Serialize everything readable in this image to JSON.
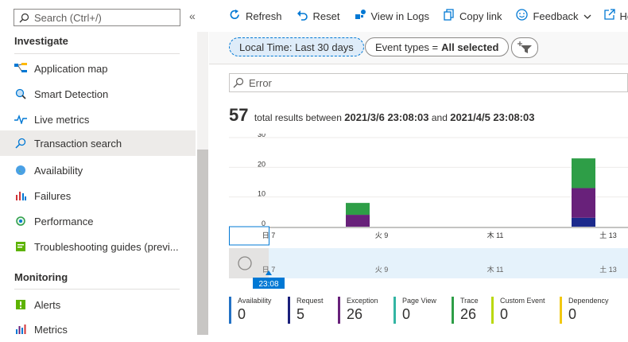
{
  "sidebar": {
    "search_placeholder": "Search (Ctrl+/)",
    "collapse_label": "«",
    "sections": [
      {
        "title": "Investigate"
      },
      {
        "title": "Monitoring"
      }
    ],
    "items": [
      {
        "label": "Application map",
        "icon": "application-map-icon"
      },
      {
        "label": "Smart Detection",
        "icon": "smart-detection-icon"
      },
      {
        "label": "Live metrics",
        "icon": "live-metrics-icon"
      },
      {
        "label": "Transaction search",
        "icon": "search-icon",
        "active": true
      },
      {
        "label": "Availability",
        "icon": "globe-icon"
      },
      {
        "label": "Failures",
        "icon": "failures-icon"
      },
      {
        "label": "Performance",
        "icon": "performance-icon"
      },
      {
        "label": "Troubleshooting guides (previ...",
        "icon": "notebook-icon"
      },
      {
        "label": "Alerts",
        "icon": "alerts-icon"
      },
      {
        "label": "Metrics",
        "icon": "metrics-icon"
      }
    ]
  },
  "toolbar": {
    "refresh": "Refresh",
    "reset": "Reset",
    "view_in_logs": "View in Logs",
    "copy_link": "Copy link",
    "feedback": "Feedback",
    "help": "Help"
  },
  "filters": {
    "time_label": "Local Time: Last 30 days",
    "event_types_prefix": "Event types =",
    "event_types_value": "All selected"
  },
  "search": {
    "value": "Error"
  },
  "results": {
    "count": "57",
    "text_between": "total results between",
    "start": "2021/3/6 23:08:03",
    "and": "and",
    "end": "2021/4/5 23:08:03"
  },
  "timeline": {
    "start_badge": "23:08"
  },
  "chart_data": {
    "type": "bar",
    "stacked": true,
    "y_ticks": [
      "30",
      "20",
      "10",
      "0"
    ],
    "ylim": [
      0,
      30
    ],
    "x_ticks": [
      "日 7",
      "火 9",
      "木 11",
      "土 13"
    ],
    "bars": [
      {
        "position": "between 火 9 and 日 7",
        "segments": [
          {
            "series": "Exception",
            "value": 4
          },
          {
            "series": "Trace",
            "value": 4
          }
        ]
      },
      {
        "position": "near 土 13",
        "segments": [
          {
            "series": "Dependency",
            "value": 3
          },
          {
            "series": "Exception",
            "value": 10
          },
          {
            "series": "Trace",
            "value": 10
          }
        ]
      }
    ],
    "colors": {
      "Exception": "#68217a",
      "Trace": "#2e9e47",
      "Dependency": "#1c2a8c"
    }
  },
  "legend": [
    {
      "name": "Availability",
      "value": "0",
      "color": "#2372c5"
    },
    {
      "name": "Request",
      "value": "5",
      "color": "#1a1f7a"
    },
    {
      "name": "Exception",
      "value": "26",
      "color": "#68217a"
    },
    {
      "name": "Page View",
      "value": "0",
      "color": "#33b5a3"
    },
    {
      "name": "Trace",
      "value": "26",
      "color": "#2e9e47"
    },
    {
      "name": "Custom Event",
      "value": "0",
      "color": "#bad80a"
    },
    {
      "name": "Dependency",
      "value": "0",
      "color": "#f2c811"
    }
  ]
}
